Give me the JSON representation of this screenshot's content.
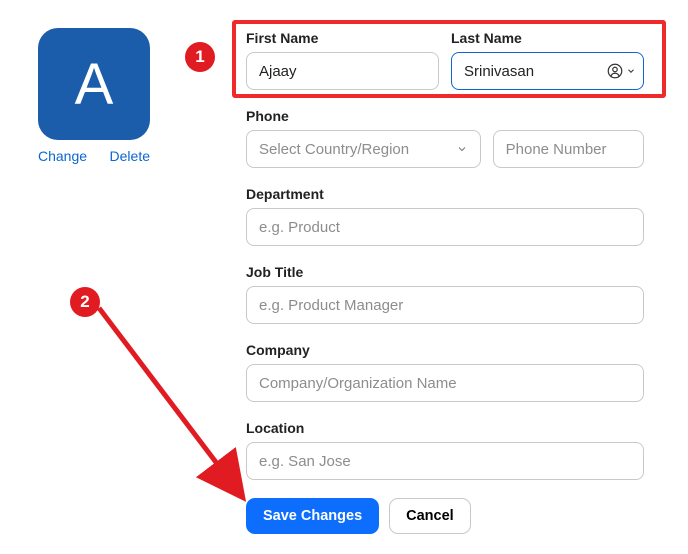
{
  "avatar": {
    "letter": "A",
    "change_label": "Change",
    "delete_label": "Delete"
  },
  "fields": {
    "first_name": {
      "label": "First Name",
      "value": "Ajaay"
    },
    "last_name": {
      "label": "Last Name",
      "value": "Srinivasan"
    },
    "phone": {
      "label": "Phone",
      "country_placeholder": "Select Country/Region",
      "number_placeholder": "Phone Number"
    },
    "department": {
      "label": "Department",
      "placeholder": "e.g. Product"
    },
    "job_title": {
      "label": "Job Title",
      "placeholder": "e.g. Product Manager"
    },
    "company": {
      "label": "Company",
      "placeholder": "Company/Organization Name"
    },
    "location": {
      "label": "Location",
      "placeholder": "e.g. San Jose"
    }
  },
  "buttons": {
    "save": "Save Changes",
    "cancel": "Cancel"
  },
  "annotations": {
    "badge1": "1",
    "badge2": "2"
  }
}
